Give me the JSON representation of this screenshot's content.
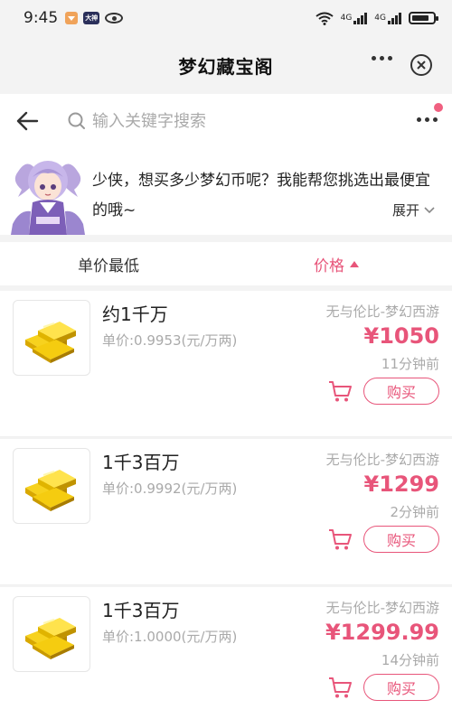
{
  "status_bar": {
    "time": "9:45",
    "app_badge_1": "",
    "app_badge_2": "大神",
    "net_1": "4G",
    "net_2": "4G"
  },
  "title_bar": {
    "title": "梦幻藏宝阁"
  },
  "search": {
    "placeholder": "输入关键字搜索"
  },
  "assistant": {
    "message": "少侠，想买多少梦幻币呢？我能帮您挑选出最便宜的哦~",
    "expand_label": "展开"
  },
  "sort": {
    "lowest_label": "单价最低",
    "price_label": "价格"
  },
  "listings": [
    {
      "amount": "约1千万",
      "unit_price": "单价:0.9953(元/万两)",
      "server": "无与伦比-梦幻西游",
      "price": "¥1050",
      "time": "11分钟前",
      "buy_label": "购买"
    },
    {
      "amount": "1千3百万",
      "unit_price": "单价:0.9992(元/万两)",
      "server": "无与伦比-梦幻西游",
      "price": "¥1299",
      "time": "2分钟前",
      "buy_label": "购买"
    },
    {
      "amount": "1千3百万",
      "unit_price": "单价:1.0000(元/万两)",
      "server": "无与伦比-梦幻西游",
      "price": "¥1299.99",
      "time": "14分钟前",
      "buy_label": "购买"
    }
  ],
  "colors": {
    "accent": "#e8557a",
    "muted_text": "#aaaaaa",
    "background": "#f3f3f3"
  }
}
